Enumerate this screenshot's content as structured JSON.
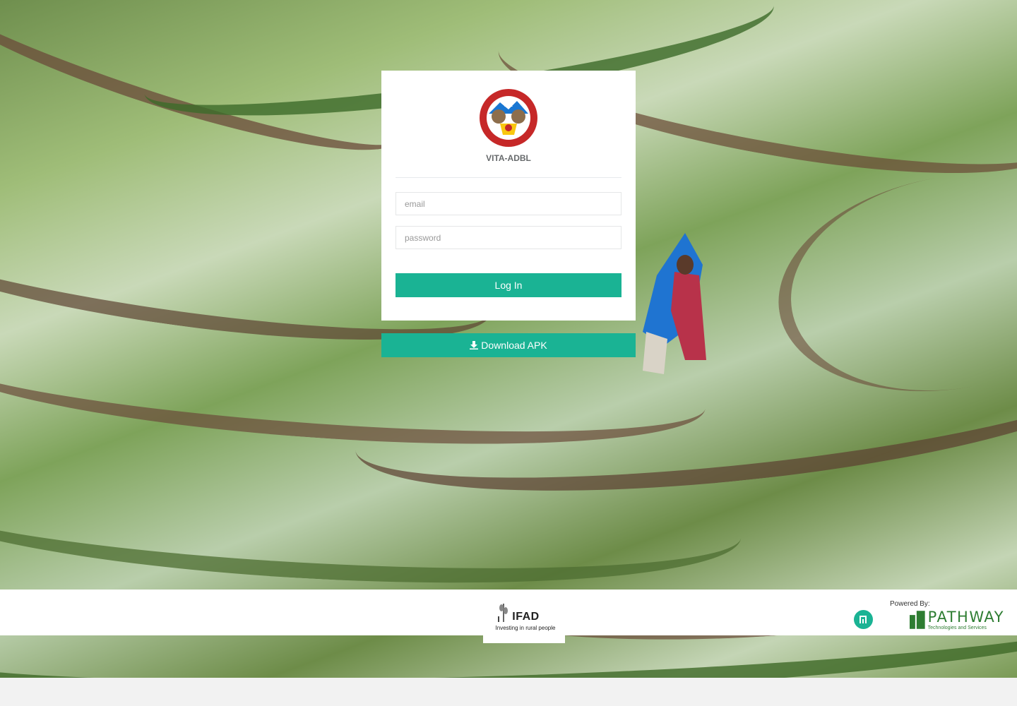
{
  "login": {
    "app_name": "VITA-ADBL",
    "email_placeholder": "email",
    "password_placeholder": "password",
    "login_label": "Log In"
  },
  "download": {
    "label": "Download APK",
    "icon": "download-icon"
  },
  "footer": {
    "ifad_name": "IFAD",
    "ifad_tagline": "Investing in rural people",
    "powered_by": "Powered By:",
    "pathway_name": "PATHWAY",
    "pathway_tagline": "Technologies and Services"
  },
  "colors": {
    "accent": "#1ab394",
    "card": "#ffffff",
    "footer": "#ffffff"
  }
}
